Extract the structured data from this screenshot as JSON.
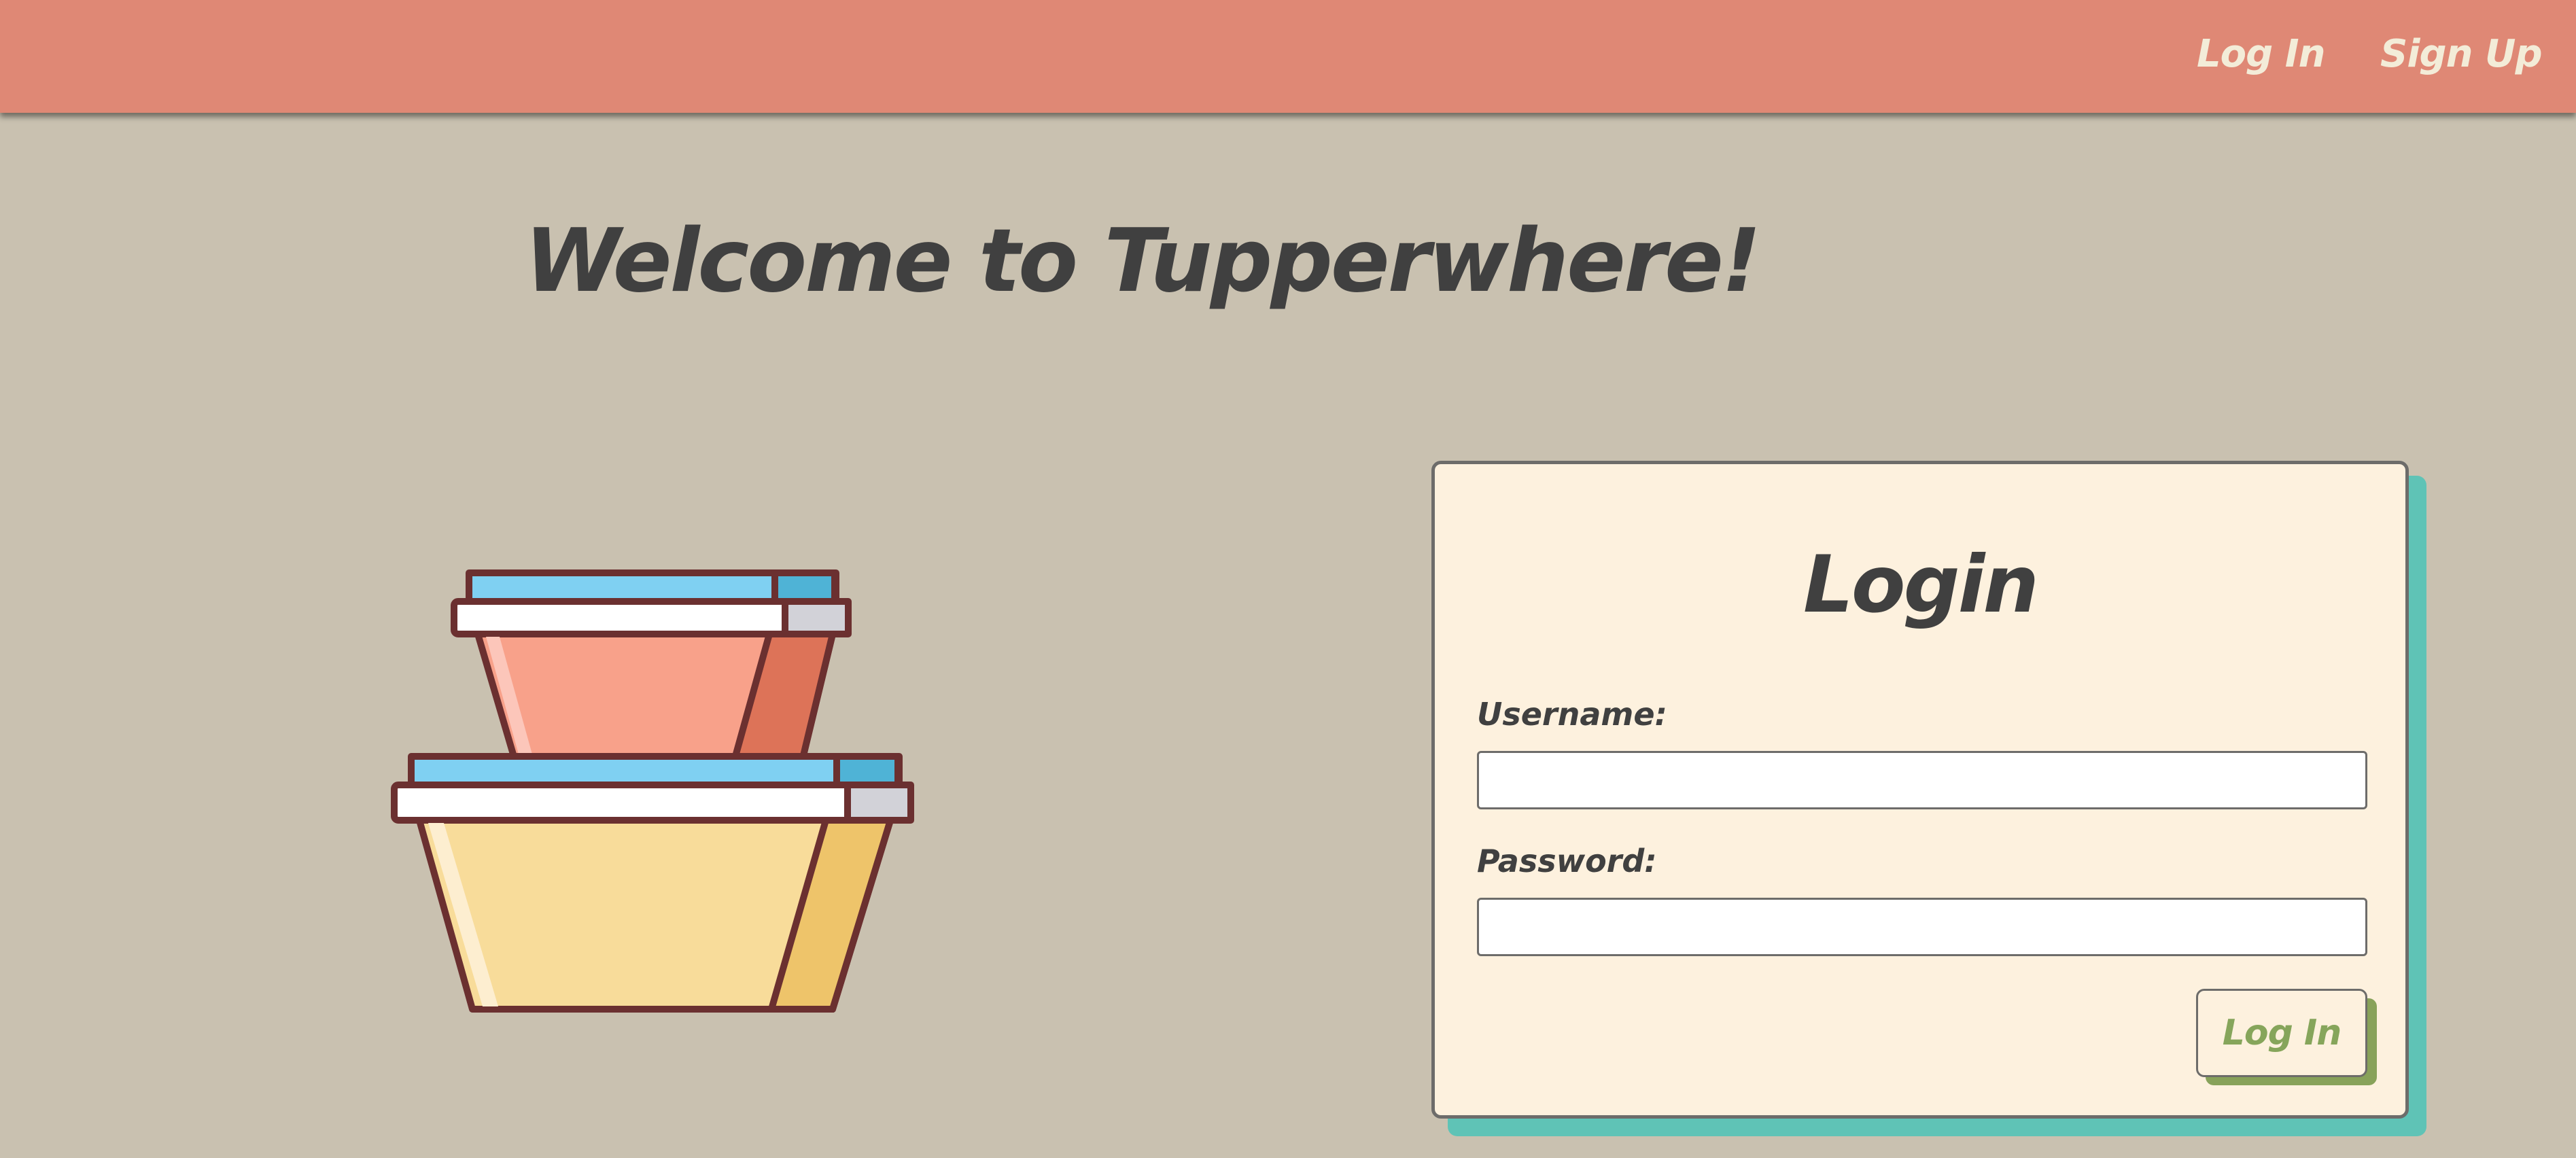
{
  "nav": {
    "login_label": "Log In",
    "signup_label": "Sign Up"
  },
  "page": {
    "title": "Welcome to Tupperwhere!"
  },
  "illustration": {
    "icon": "stacked-food-containers-icon"
  },
  "login_form": {
    "title": "Login",
    "username_label": "Username:",
    "username_value": "",
    "password_label": "Password:",
    "password_value": "",
    "submit_label": "Log In"
  },
  "colors": {
    "header": "#df8875",
    "background": "#c9c1b0",
    "card": "#fdf1de",
    "card_shadow": "#5fc3b6",
    "button_text": "#86a55b",
    "button_shadow": "#88a25a",
    "text_dark": "#404040",
    "nav_text": "#f3ecd8"
  }
}
